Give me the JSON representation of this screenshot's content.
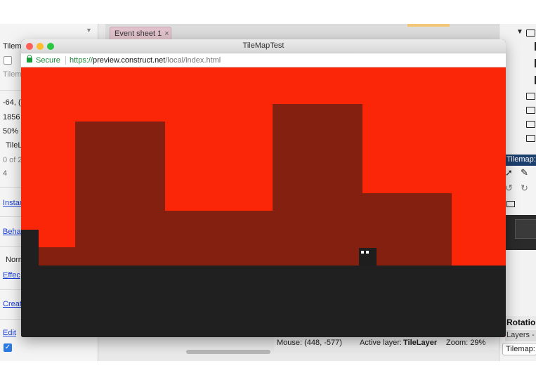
{
  "editor": {
    "left_panel": {
      "rows": [
        "Tilem",
        "Tilem",
        "-64, (",
        "1856",
        "50%",
        "TileL",
        "0 of 2",
        "4"
      ],
      "links": [
        "Instar",
        "Behav",
        "Effec",
        "Creat",
        "Edit"
      ],
      "dropdown_value": "Norm"
    },
    "tabs": {
      "event_sheet_label": "Event sheet 1",
      "close_glyph": "×"
    },
    "status_bar": {
      "mouse": "Mouse: (448, -577)",
      "active_layer_label": "Active layer:",
      "active_layer_value": "TileLayer",
      "zoom": "Zoom: 29%"
    },
    "right_panel": {
      "tilemap_bar": "Tilemap: T",
      "rotation_label": "Rotation",
      "layers_tab": "Layers -",
      "tilemap_tab": "Tilemap:"
    }
  },
  "preview": {
    "window_title": "TileMapTest",
    "secure_label": "Secure",
    "url_scheme": "https://",
    "url_host": "preview.construct.net",
    "url_path": "/local/index.html"
  },
  "colors": {
    "sky": "#fa2607",
    "background_tiles": "#84200f",
    "ground": "#202020",
    "player": "#1e1e1e"
  },
  "icons": {
    "traffic_lights": [
      "close-light-icon",
      "minimize-light-icon",
      "zoom-light-icon"
    ],
    "lock": "lock-icon",
    "tools": [
      "pointer-icon",
      "pencil-icon",
      "rotate-ccw-icon",
      "rotate-cw-icon",
      "folder-icon"
    ]
  }
}
